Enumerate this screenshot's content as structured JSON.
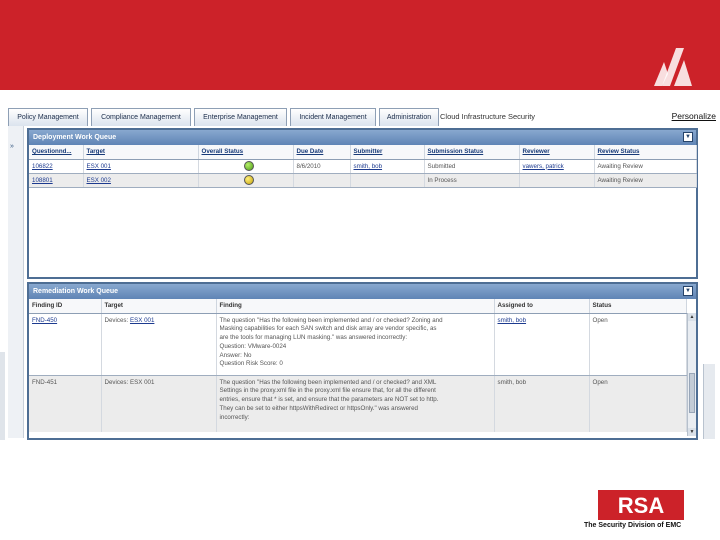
{
  "colors": {
    "header_red": "#cc2229",
    "panel_border": "#4e6e94",
    "status_green": "#6bb82a",
    "status_yellow": "#e2c21a"
  },
  "tabs": [
    {
      "label": "Policy Management"
    },
    {
      "label": "Compliance Management"
    },
    {
      "label": "Enterprise Management"
    },
    {
      "label": "Incident Management"
    },
    {
      "label": "Administration"
    }
  ],
  "current_section": "Cloud Infrastructure Security",
  "personalize_link": "Personalize",
  "deployment_queue": {
    "title": "Deployment Work Queue",
    "columns": [
      "Questionnd...",
      "Target",
      "Overall Status",
      "Due Date",
      "Submitter",
      "Submission Status",
      "Reviewer",
      "Review Status"
    ],
    "rows": [
      {
        "questionnaire": "106822",
        "target": "ESX 001",
        "overall_status": "green",
        "due_date": "8/6/2010",
        "submitter": "smith, bob",
        "submission_status": "Submitted",
        "reviewer": "vawers, patrick",
        "review_status": "Awaiting Review"
      },
      {
        "questionnaire": "108801",
        "target": "ESX 002",
        "overall_status": "yellow",
        "due_date": "",
        "submitter": "",
        "submission_status": "In Process",
        "reviewer": "",
        "review_status": "Awaiting Review"
      }
    ]
  },
  "remediation_queue": {
    "title": "Remediation Work Queue",
    "columns": [
      "Finding ID",
      "Target",
      "Finding",
      "Assigned to",
      "Status"
    ],
    "rows": [
      {
        "finding_id": "FND-450",
        "target_prefix": "Devices:",
        "target_link": "ESX 001",
        "finding_lines": [
          "The question \"Has the following been implemented and / or checked? Zoning and",
          "Masking capabilities for each SAN switch and disk array are vendor specific, as",
          "are the tools for managing LUN masking.\" was answered incorrectly:",
          "Question: VMware-0024",
          "Answer: No",
          "Question Risk Score: 0"
        ],
        "assigned_to": "smith, bob",
        "status": "Open"
      },
      {
        "finding_id": "FND-451",
        "target_prefix": "Devices:",
        "target_link": "ESX 001",
        "finding_lines": [
          "The question \"Has the following been implemented and / or checked? and XML",
          "Settings in the proxy.xml file in the proxy.xml file ensure that, for all the different",
          "entries, ensure that * is set, and ensure that the parameters are NOT set to http.",
          "They can be set to either httpsWithRedirect or httpsOnly.\" was answered",
          "incorrectly:"
        ],
        "assigned_to": "smith, bob",
        "status": "Open"
      }
    ]
  },
  "branding": {
    "logo": "RSA",
    "tagline": "The Security Division of EMC"
  }
}
